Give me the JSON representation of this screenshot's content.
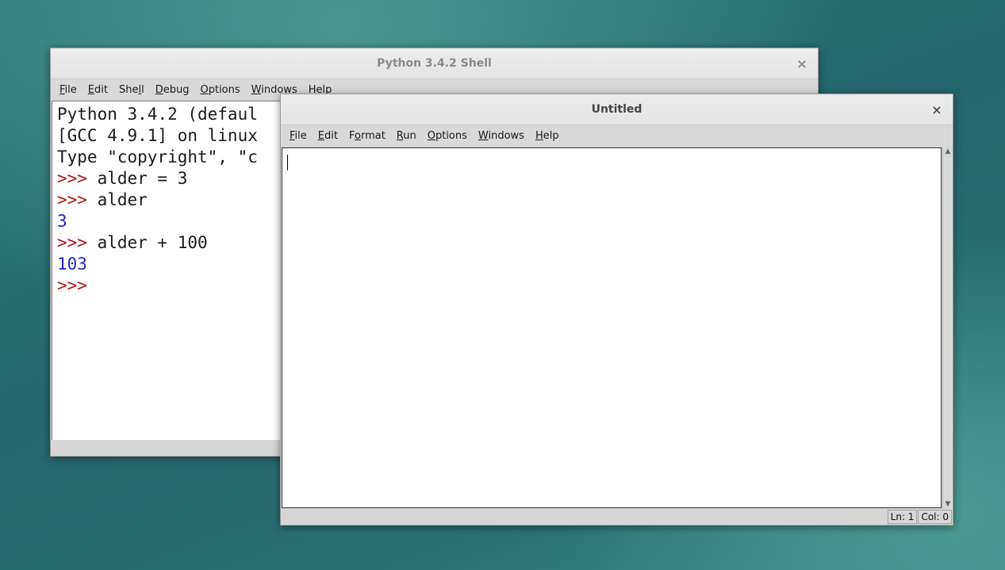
{
  "shell": {
    "title": "Python 3.4.2 Shell",
    "close": "×",
    "menu": [
      {
        "label": "File",
        "mnemonic_index": 0
      },
      {
        "label": "Edit",
        "mnemonic_index": 0
      },
      {
        "label": "Shell",
        "mnemonic_index": 3
      },
      {
        "label": "Debug",
        "mnemonic_index": 0
      },
      {
        "label": "Options",
        "mnemonic_index": 0
      },
      {
        "label": "Windows",
        "mnemonic_index": 0
      },
      {
        "label": "Help",
        "mnemonic_index": 0
      }
    ],
    "lines": [
      {
        "prompt": "",
        "text": "Python 3.4.2 (defaul",
        "type": "banner"
      },
      {
        "prompt": "",
        "text": "[GCC 4.9.1] on linux",
        "type": "banner"
      },
      {
        "prompt": "",
        "text": "Type \"copyright\", \"c",
        "type": "banner"
      },
      {
        "prompt": ">>> ",
        "text": "alder = 3",
        "type": "input"
      },
      {
        "prompt": ">>> ",
        "text": "alder",
        "type": "input"
      },
      {
        "prompt": "",
        "text": "3",
        "type": "output"
      },
      {
        "prompt": ">>> ",
        "text": "alder + 100",
        "type": "input"
      },
      {
        "prompt": "",
        "text": "103",
        "type": "output"
      },
      {
        "prompt": ">>> ",
        "text": "",
        "type": "input"
      }
    ]
  },
  "editor": {
    "title": "Untitled",
    "close": "×",
    "menu": [
      {
        "label": "File",
        "mnemonic_index": 0
      },
      {
        "label": "Edit",
        "mnemonic_index": 0
      },
      {
        "label": "Format",
        "mnemonic_index": 1
      },
      {
        "label": "Run",
        "mnemonic_index": 0
      },
      {
        "label": "Options",
        "mnemonic_index": 0
      },
      {
        "label": "Windows",
        "mnemonic_index": 0
      },
      {
        "label": "Help",
        "mnemonic_index": 0
      }
    ],
    "content": "",
    "status": {
      "line": "Ln: 1",
      "col": "Col: 0"
    },
    "scroll_up_icon": "▲",
    "scroll_down_icon": "▼"
  },
  "colors": {
    "prompt": "#b01616",
    "output": "#2222c8",
    "desktop": "#2a6f72"
  }
}
